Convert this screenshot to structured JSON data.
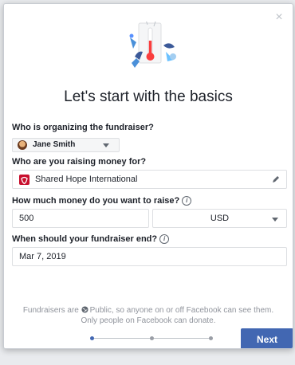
{
  "dialog": {
    "close_glyph": "×",
    "heading": "Let's start with the basics"
  },
  "organizer": {
    "label": "Who is organizing the fundraiser?",
    "selected": "Jane Smith"
  },
  "beneficiary": {
    "label": "Who are you raising money for?",
    "value": "Shared Hope International"
  },
  "goal": {
    "label": "How much money do you want to raise?",
    "amount": "500",
    "currency": "USD"
  },
  "end_date": {
    "label": "When should your fundraiser end?",
    "value": "Mar 7, 2019"
  },
  "footer": {
    "text_before": "Fundraisers are ",
    "text_after": "Public, so anyone on or off Facebook can see them. Only people on Facebook can donate."
  },
  "steps": {
    "total": 3,
    "current": 1
  },
  "buttons": {
    "next": "Next"
  },
  "colors": {
    "accent": "#4267b2",
    "charity_red": "#c8102e"
  }
}
